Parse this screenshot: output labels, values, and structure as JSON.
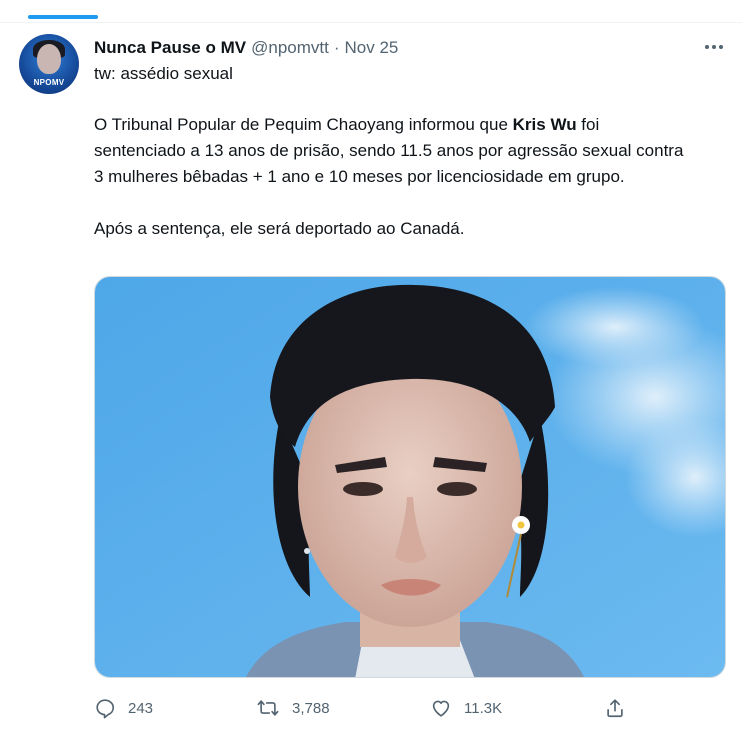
{
  "tweet": {
    "author": {
      "display_name": "Nunca Pause o MV",
      "handle": "@npomvtt",
      "separator": "·",
      "date": "Nov 25",
      "avatar_label": "NPOMV"
    },
    "content_warning": "tw: assédio sexual",
    "body": {
      "p1_before": "O Tribunal Popular de Pequim Chaoyang informou que ",
      "p1_bold": "Kris Wu",
      "p1_after": " foi sentenciado a 13 anos de prisão, sendo 11.5 anos por agressão sexual contra 3 mulheres bêbadas + 1 ano e 10 meses por licenciosidade em grupo.",
      "p2": "Após a sentença, ele será deportado ao Canadá."
    },
    "actions": {
      "replies": "243",
      "retweets": "3,788",
      "likes": "11.3K"
    }
  },
  "colors": {
    "accent": "#1d9bf0",
    "text": "#0f1419",
    "muted": "#536471",
    "border": "#cfd9de"
  }
}
